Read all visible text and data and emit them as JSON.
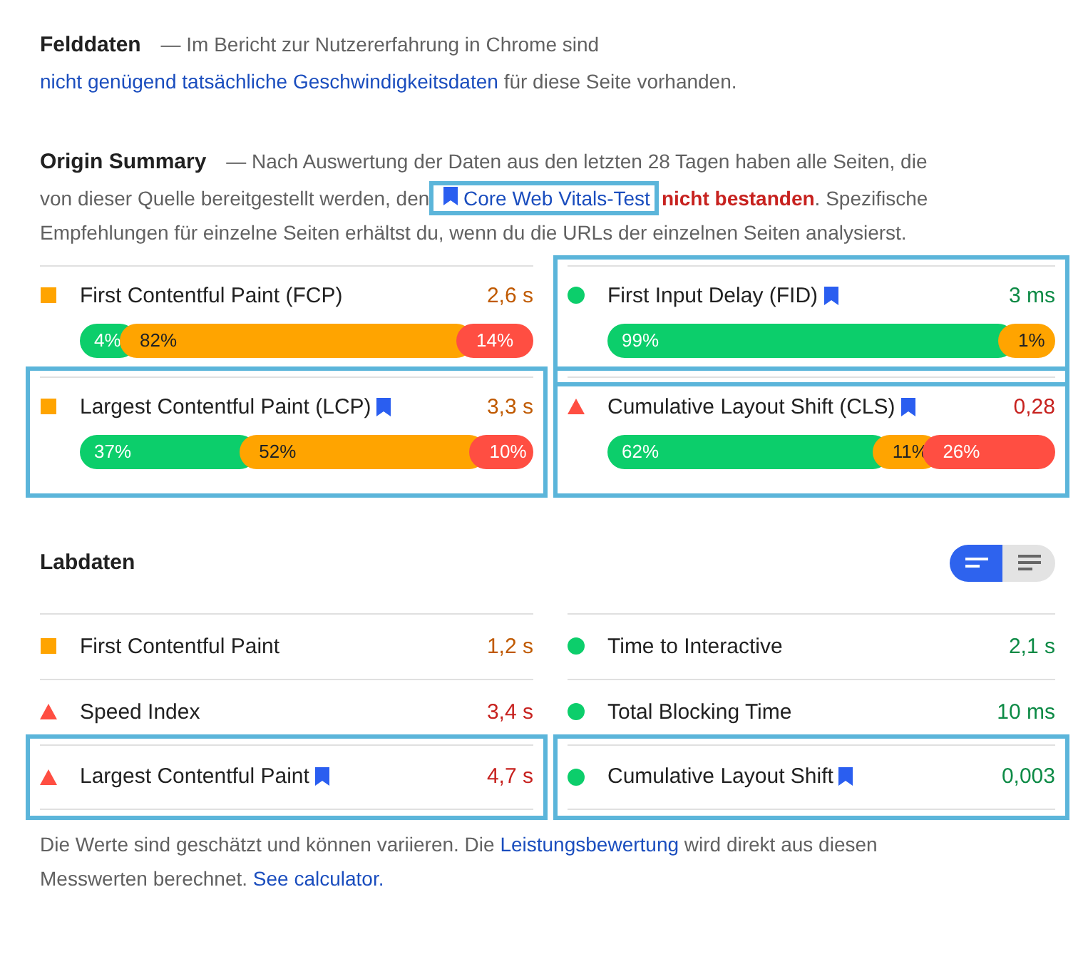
{
  "field_data": {
    "title": "Felddaten",
    "description": [
      {
        "kind": "text",
        "text": "— Im Bericht zur Nutzererfahrung in Chrome sind "
      },
      {
        "kind": "link",
        "text": "nicht genügend tatsächliche Geschwindigkeitsdaten"
      },
      {
        "kind": "text",
        "text": " für diese Seite vorhanden."
      }
    ]
  },
  "origin_summary": {
    "title": "Origin Summary",
    "description": [
      {
        "kind": "text",
        "text": "— Nach Auswertung der Daten aus den letzten 28 Tagen haben alle Seiten, die von dieser Quelle bereitgestellt werden, den "
      },
      {
        "kind": "vital_link",
        "text": "Core Web Vitals-Test",
        "highlighted": true
      },
      {
        "kind": "fail",
        "text": "nicht bestanden"
      },
      {
        "kind": "text",
        "text": ". Spezifische Empfehlungen für einzelne Seiten erhältst du, wenn du die URLs der einzelnen Seiten analysierst."
      }
    ],
    "metrics": [
      {
        "kind": "average",
        "title": "First Contentful Paint (FCP)",
        "core_vital": false,
        "highlighted": false,
        "value": "2,6 s",
        "distribution": [
          {
            "color": "#0cce6b",
            "label": "4%"
          },
          {
            "color": "#ffa400",
            "label": "82%"
          },
          {
            "color": "#ff4e42",
            "label": "14%"
          }
        ]
      },
      {
        "kind": "fast",
        "title": "First Input Delay (FID)",
        "core_vital": true,
        "highlighted": true,
        "value": "3 ms",
        "distribution": [
          {
            "color": "#0cce6b",
            "label": "99%"
          },
          {
            "color": "#ffa400",
            "label": "1%"
          }
        ]
      },
      {
        "kind": "average",
        "title": "Largest Contentful Paint (LCP)",
        "core_vital": true,
        "highlighted": true,
        "value": "3,3 s",
        "distribution": [
          {
            "color": "#0cce6b",
            "label": "37%"
          },
          {
            "color": "#ffa400",
            "label": "52%"
          },
          {
            "color": "#ff4e42",
            "label": "10%"
          }
        ]
      },
      {
        "kind": "slow",
        "title": "Cumulative Layout Shift (CLS)",
        "core_vital": true,
        "highlighted": true,
        "value": "0,28",
        "distribution": [
          {
            "color": "#0cce6b",
            "label": "62%"
          },
          {
            "color": "#ffa400",
            "label": "11%"
          },
          {
            "color": "#ff4e42",
            "label": "26%"
          }
        ]
      }
    ]
  },
  "lab_data": {
    "title": "Labdaten",
    "view_toggle": [
      {
        "selected": true
      },
      {
        "selected": false
      }
    ],
    "metrics": [
      {
        "kind": "average",
        "title": "First Contentful Paint",
        "core_vital": false,
        "highlighted": false,
        "value": "1,2 s"
      },
      {
        "kind": "fast",
        "title": "Time to Interactive",
        "core_vital": false,
        "highlighted": false,
        "value": "2,1 s"
      },
      {
        "kind": "slow",
        "title": "Speed Index",
        "core_vital": false,
        "highlighted": false,
        "value": "3,4 s"
      },
      {
        "kind": "fast",
        "title": "Total Blocking Time",
        "core_vital": false,
        "highlighted": false,
        "value": "10 ms"
      },
      {
        "kind": "slow",
        "title": "Largest Contentful Paint",
        "core_vital": true,
        "highlighted": true,
        "value": "4,7 s"
      },
      {
        "kind": "fast",
        "title": "Cumulative Layout Shift",
        "core_vital": true,
        "highlighted": true,
        "value": "0,003"
      }
    ],
    "footnote": [
      {
        "kind": "text",
        "text": "Die Werte sind geschätzt und können variieren. Die "
      },
      {
        "kind": "link",
        "text": "Leistungsbewertung"
      },
      {
        "kind": "text",
        "text": " wird direkt aus diesen Messwerten berechnet. "
      },
      {
        "kind": "link",
        "text": "See calculator."
      }
    ]
  }
}
